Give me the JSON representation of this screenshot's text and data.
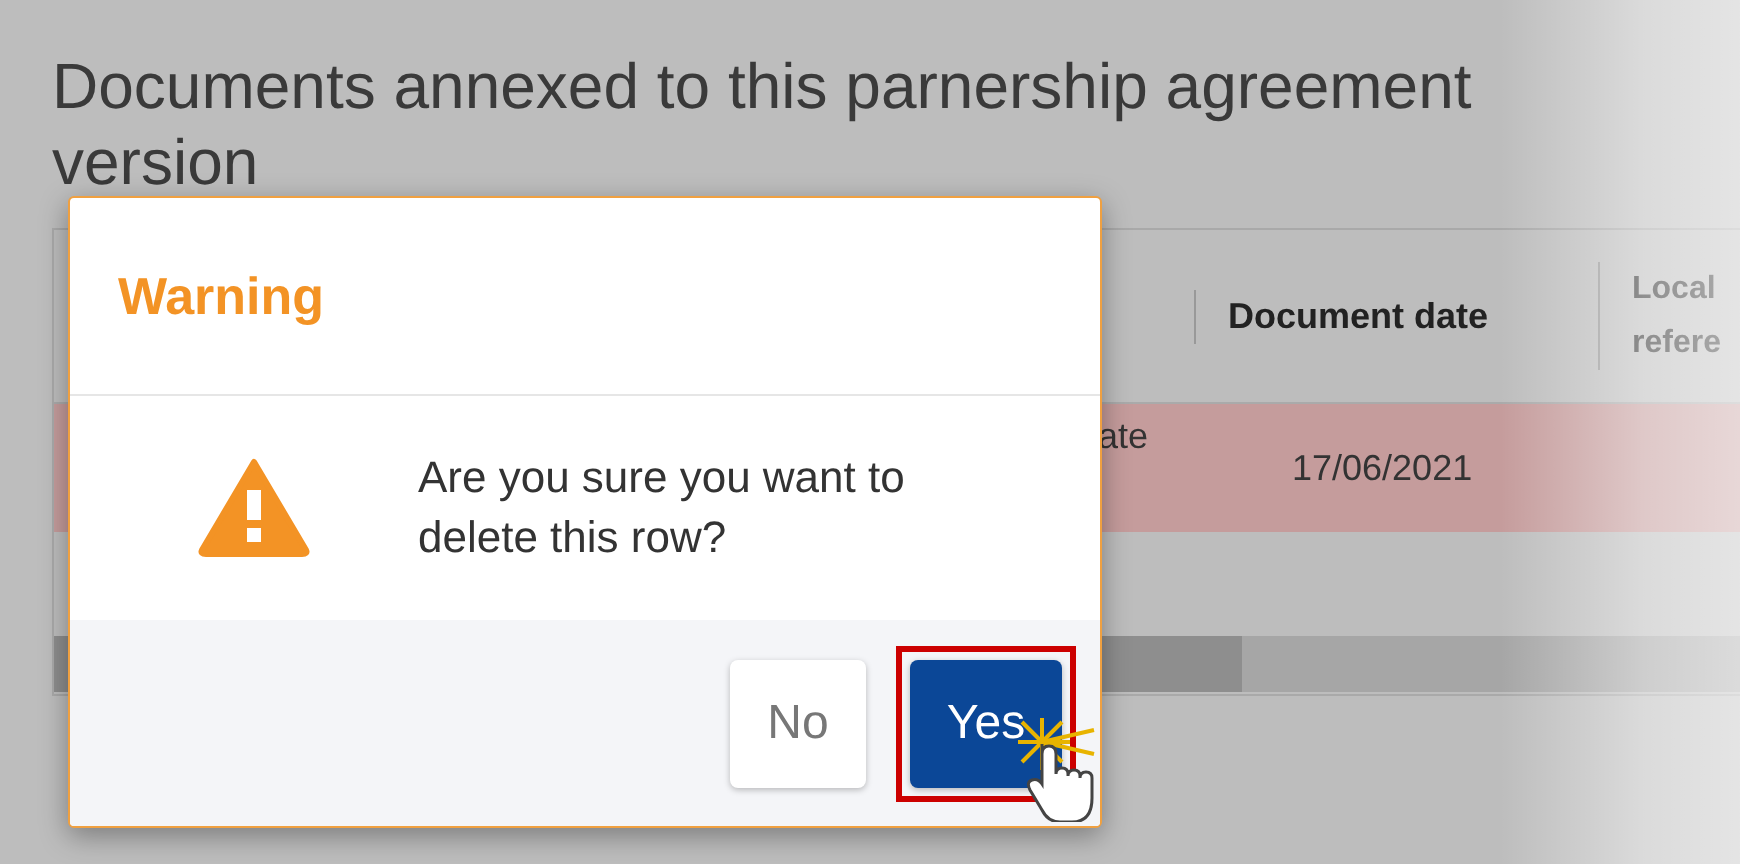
{
  "page": {
    "title": "Documents annexed to this parnership agreement version"
  },
  "table": {
    "columns": [
      "Document date",
      "Local refere"
    ],
    "rows": [
      {
        "column_1": "ate",
        "document_date": "17/06/2021",
        "selected": true
      }
    ]
  },
  "dialog": {
    "title": "Warning",
    "message": "Are you sure you want to delete this row?",
    "buttons": [
      {
        "label": "No",
        "kind": "secondary",
        "highlighted": false
      },
      {
        "label": "Yes",
        "kind": "primary",
        "highlighted": true
      }
    ]
  }
}
